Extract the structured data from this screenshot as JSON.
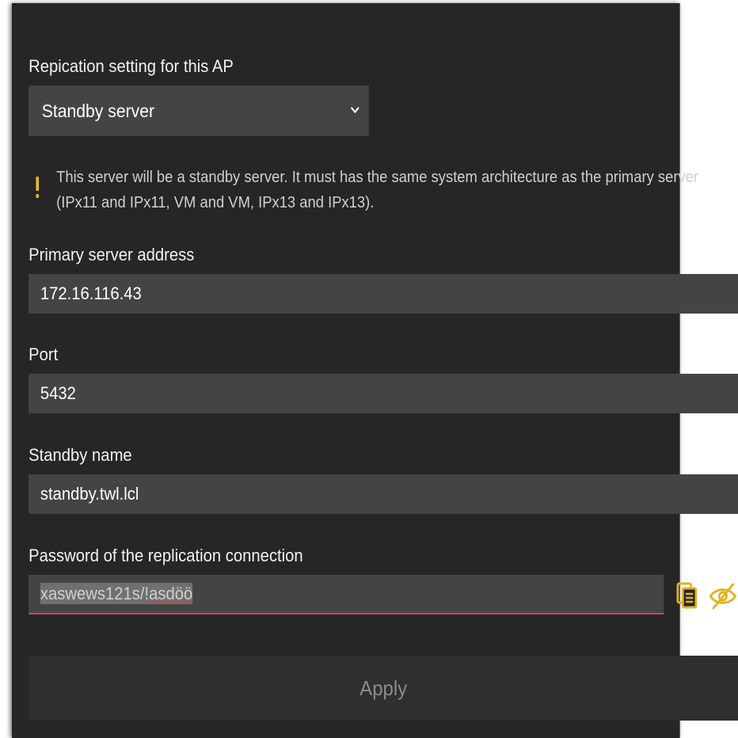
{
  "replication": {
    "label": "Repication setting for this AP",
    "selected": "Standby server"
  },
  "notice": {
    "text": "This server will be a standby server. It must has the same system architecture as the primary server (IPx11 and IPx11, VM and VM, IPx13 and IPx13)."
  },
  "primary_address": {
    "label": "Primary server address",
    "value": "172.16.116.43"
  },
  "port": {
    "label": "Port",
    "value": "5432"
  },
  "standby_name": {
    "label": "Standby name",
    "value": "standby.twl.lcl"
  },
  "password": {
    "label": "Password of the replication connection",
    "value_prefix": "xaswews121s/!",
    "value_suffix": "asdöö"
  },
  "apply": {
    "label": "Apply"
  },
  "colors": {
    "panel_bg": "#262626",
    "field_bg": "#444444",
    "warning": "#e8b923",
    "icon_accent": "#e0b321",
    "error_underline": "#c9475c"
  },
  "icons": {
    "chevron": "chevron-down-icon",
    "warning": "warning-icon",
    "copy": "copy-icon",
    "visibility": "eye-off-icon"
  }
}
